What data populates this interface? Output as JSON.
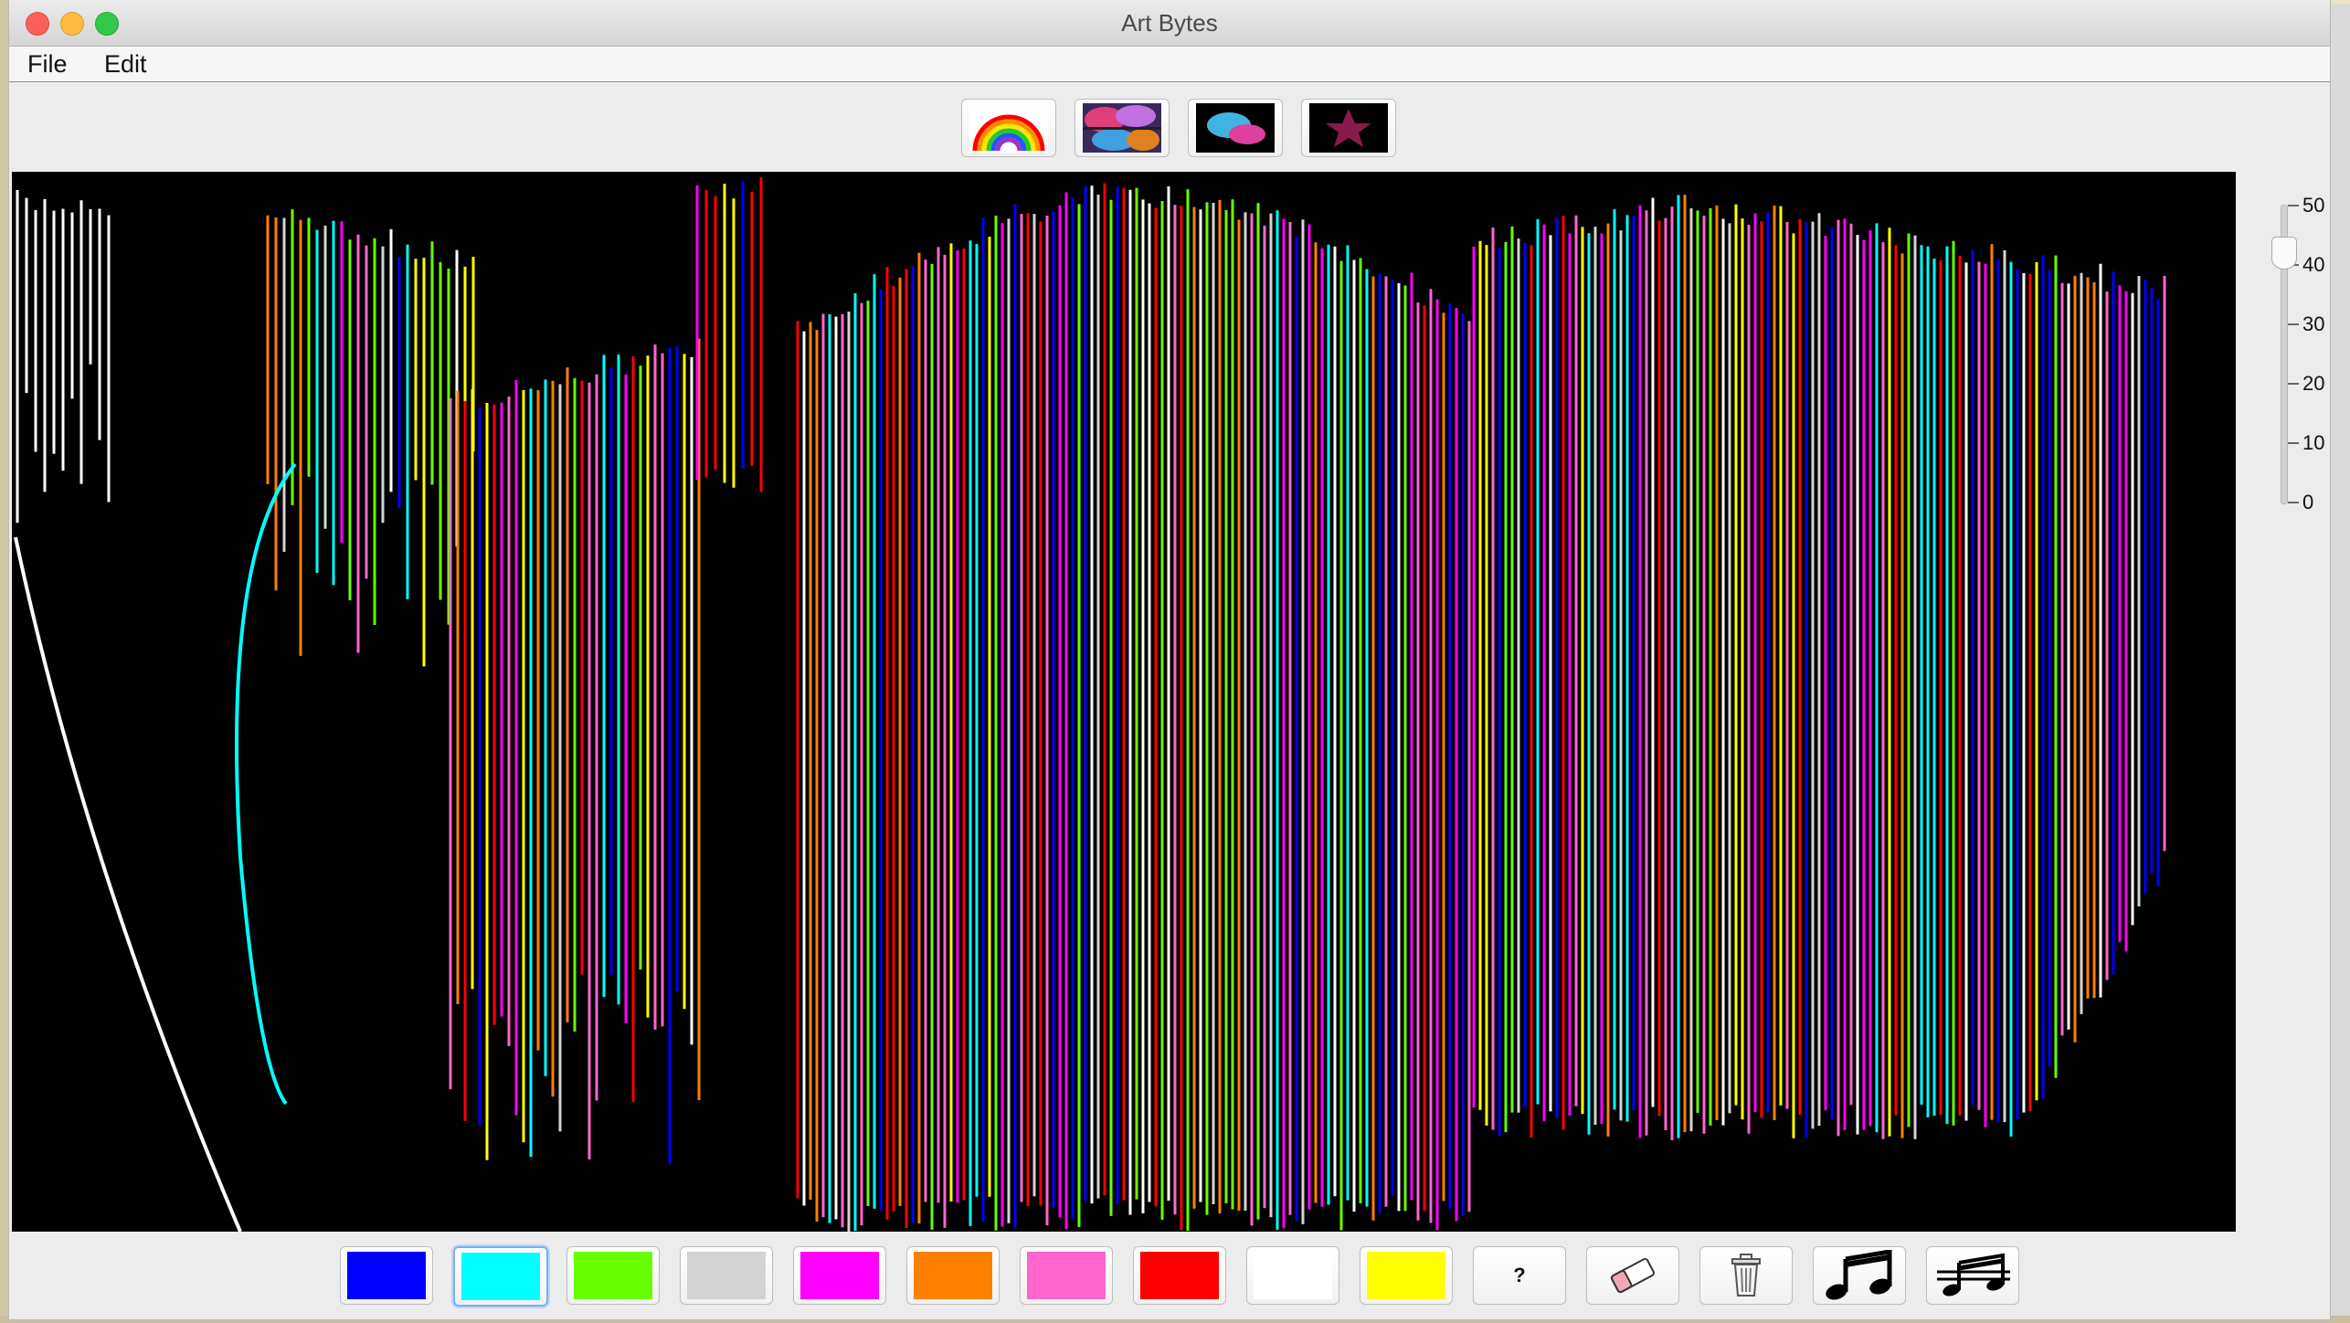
{
  "window": {
    "title": "Art Bytes"
  },
  "menu": [
    {
      "label": "File"
    },
    {
      "label": "Edit"
    }
  ],
  "top_tools": [
    {
      "name": "rainbow-brush",
      "icon": "rainbow-icon"
    },
    {
      "name": "photo-collage",
      "icon": "collage-icon"
    },
    {
      "name": "bubble-shapes",
      "icon": "bubbles-icon"
    },
    {
      "name": "star-stamp",
      "icon": "star-icon"
    }
  ],
  "brush_size": {
    "value": 42,
    "min": 0,
    "max": 50,
    "ticks": [
      "50",
      "40",
      "30",
      "20",
      "10",
      "0"
    ]
  },
  "palette": [
    {
      "name": "blue",
      "color": "#0000ff"
    },
    {
      "name": "cyan",
      "color": "#00ffff",
      "selected": true
    },
    {
      "name": "green",
      "color": "#66ff00"
    },
    {
      "name": "light-gray",
      "color": "#d3d3d3"
    },
    {
      "name": "magenta",
      "color": "#ff00ff"
    },
    {
      "name": "orange",
      "color": "#ff8000"
    },
    {
      "name": "pink",
      "color": "#ff66cc"
    },
    {
      "name": "red",
      "color": "#ff0000"
    },
    {
      "name": "white",
      "color": "#ffffff"
    },
    {
      "name": "yellow",
      "color": "#ffff00"
    }
  ],
  "actions": {
    "random_label": "?",
    "eraser": "eraser-icon",
    "trash": "trash-icon",
    "music_on": "music-notes-icon",
    "music_off": "music-notes-muted-icon"
  }
}
